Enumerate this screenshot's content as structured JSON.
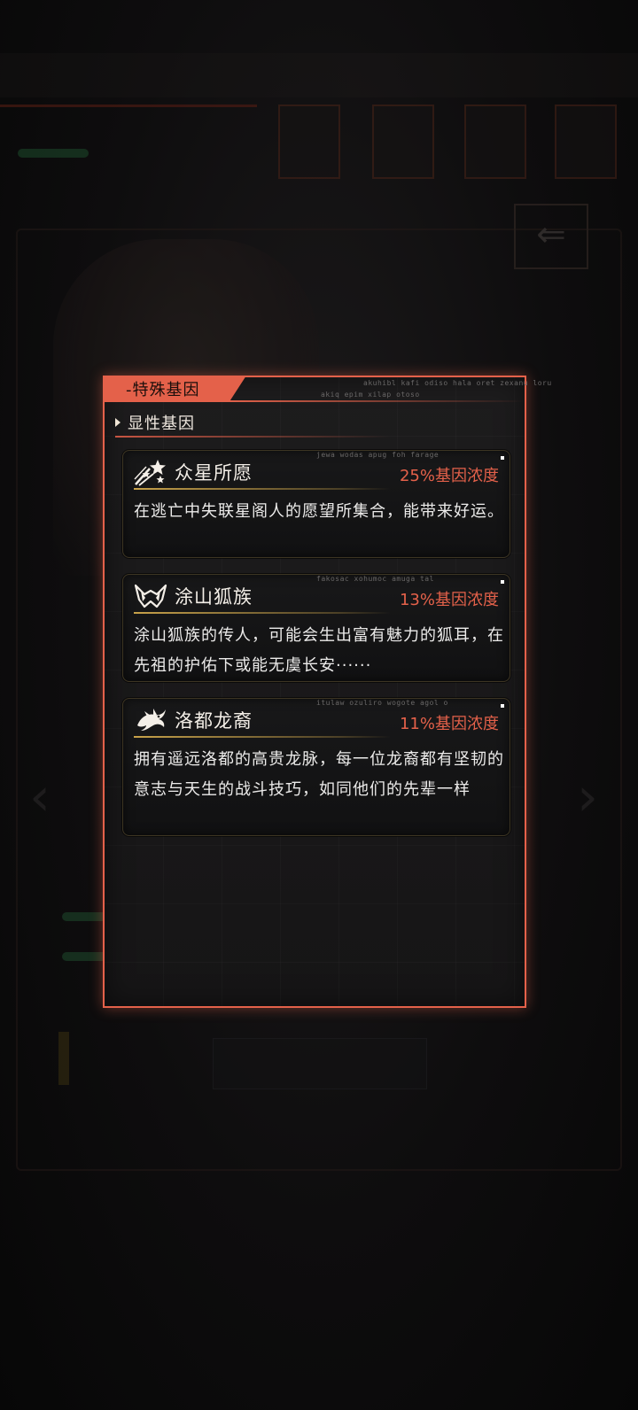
{
  "dialog": {
    "tab_title": "-特殊基因",
    "section_title": "显性基因",
    "deco_top_1": "akuhibl kafi odiso hala oret zexanu loru",
    "deco_top_2": "akiq epim xilap otoso"
  },
  "genes": [
    {
      "icon": "shooting-stars-icon",
      "title": "众星所愿",
      "concentration": "25%基因浓度",
      "description": "在逃亡中失联星阁人的愿望所集合，能带来好运。",
      "deco": "jewa wodas apug foh farage"
    },
    {
      "icon": "fox-ears-icon",
      "title": "涂山狐族",
      "concentration": "13%基因浓度",
      "description": "涂山狐族的传人，可能会生出富有魅力的狐耳，在先祖的护佑下或能无虞长安······",
      "deco": "fakosac xohumoc amuga tal"
    },
    {
      "icon": "dragon-icon",
      "title": "洛都龙裔",
      "concentration": "11%基因浓度",
      "description": "拥有遥远洛都的高贵龙脉，每一位龙裔都有坚韧的意志与天生的战斗技巧，如同他们的先辈一样",
      "deco": "itulaw ozuliro wogote agol o"
    }
  ],
  "colors": {
    "accent": "#e4614a",
    "gold_line": "#c8a24a",
    "text": "#ecebea"
  }
}
